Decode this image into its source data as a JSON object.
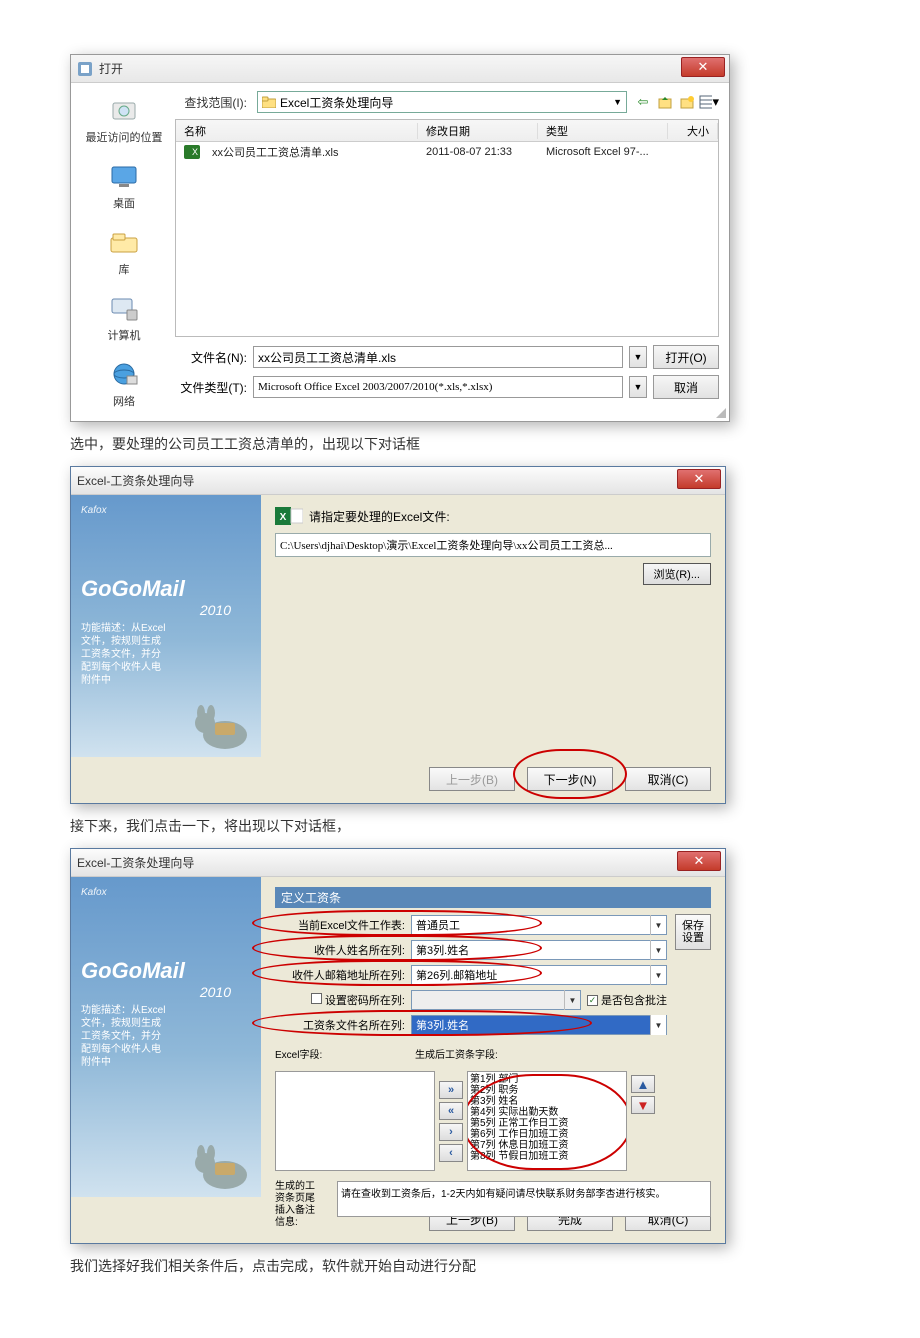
{
  "fileDialog": {
    "title": "打开",
    "lookInLabel": "查找范围(I):",
    "lookInValue": "Excel工资条处理向导",
    "side": {
      "recent": "最近访问的位置",
      "desktop": "桌面",
      "library": "库",
      "computer": "计算机",
      "network": "网络"
    },
    "headers": {
      "name": "名称",
      "date": "修改日期",
      "type": "类型",
      "size": "大小"
    },
    "row": {
      "name": "xx公司员工工资总清单.xls",
      "date": "2011-08-07 21:33",
      "type": "Microsoft Excel 97-..."
    },
    "fileNameLabel": "文件名(N):",
    "fileNameValue": "xx公司员工工资总清单.xls",
    "fileTypeLabel": "文件类型(T):",
    "fileTypeValue": "Microsoft Office Excel 2003/2007/2010(*.xls,*.xlsx)",
    "openBtn": "打开(O)",
    "cancelBtn": "取消"
  },
  "doc": {
    "p1": "选中，要处理的公司员工工资总清单的，出现以下对话框",
    "p2": "接下来，我们点击一下，将出现以下对话框，",
    "p3": "我们选择好我们相关条件后，点击完成，软件就开始自动进行分配"
  },
  "wiz1": {
    "title": "Excel-工资条处理向导",
    "brandSmall": "Kafox",
    "brand": "GoGoMail",
    "year": "2010",
    "desc": "功能描述：从Excel\n文件，按规则生成\n工资条文件，并分\n配到每个收件人电\n附件中",
    "prompt": "请指定要处理的Excel文件:",
    "path": "C:\\Users\\djhai\\Desktop\\演示\\Excel工资条处理向导\\xx公司员工工资总...",
    "browse": "浏览(R)...",
    "back": "上一步(B)",
    "next": "下一步(N)",
    "cancel": "取消(C)"
  },
  "wiz2": {
    "title": "Excel-工资条处理向导",
    "group": "定义工资条",
    "labels": {
      "sheet": "当前Excel文件工作表:",
      "nameCol": "收件人姓名所在列:",
      "mailCol": "收件人邮箱地址所在列:",
      "pwdCol": "设置密码所在列:",
      "fileCol": "工资条文件名所在列:",
      "left": "Excel字段:",
      "right": "生成后工资条字段:"
    },
    "values": {
      "sheet": "普通员工",
      "nameCol": "第3列.姓名",
      "mailCol": "第26列.邮箱地址",
      "pwdCol": "",
      "fileCol": "第3列.姓名",
      "remarkChk": "是否包含批注"
    },
    "save": "保存\n设置",
    "rightList": [
      "第1列 部门",
      "第2列 职务",
      "第3列 姓名",
      "第4列 实际出勤天数",
      "第5列 正常工作日工资",
      "第6列 工作日加班工资",
      "第7列 休息日加班工资",
      "第8列 节假日加班工资"
    ],
    "memoLabel": "生成的工\n资条页尾\n插入备注\n信息:",
    "memoText": "请在查收到工资条后，1-2天内如有疑问请尽快联系财务部李杏进行核实。",
    "back": "上一步(B)",
    "finish": "完成",
    "cancel": "取消(C)"
  }
}
